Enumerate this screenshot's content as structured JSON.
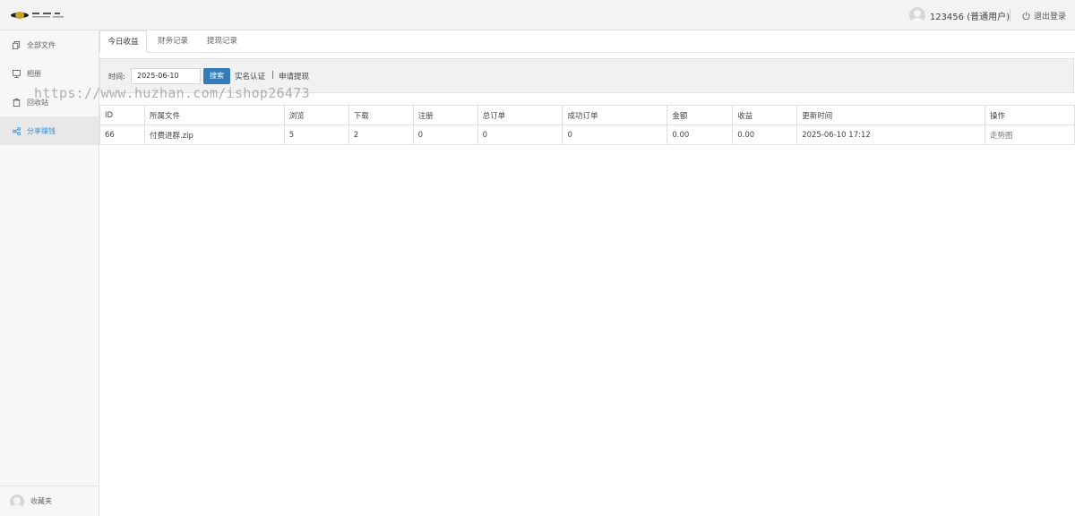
{
  "header": {
    "user_name": "123456 (普通用户)",
    "logout_label": "退出登录"
  },
  "sidebar": {
    "items": [
      {
        "label": "全部文件",
        "icon": "files-icon"
      },
      {
        "label": "相册",
        "icon": "monitor-icon"
      },
      {
        "label": "回收站",
        "icon": "trash-icon"
      },
      {
        "label": "分享赚钱",
        "icon": "share-icon",
        "active": true
      }
    ],
    "favorites_label": "收藏夹"
  },
  "watermark": "https://www.huzhan.com/ishop26473",
  "tabs": [
    {
      "label": "今日收益",
      "active": true
    },
    {
      "label": "财务记录"
    },
    {
      "label": "提现记录"
    }
  ],
  "filter": {
    "time_label": "时间:",
    "date_value": "2025-06-10",
    "search_label": "搜索",
    "verify_label": "实名认证",
    "separator": "|",
    "withdraw_label": "申请提现"
  },
  "table": {
    "headers": [
      "ID",
      "所属文件",
      "浏览",
      "下载",
      "注册",
      "总订单",
      "成功订单",
      "金额",
      "收益",
      "更新时间",
      "操作"
    ],
    "rows": [
      [
        "66",
        "付费进群.zip",
        "5",
        "2",
        "0",
        "0",
        "0",
        "0.00",
        "0.00",
        "2025-06-10 17:12",
        "走势图"
      ]
    ]
  },
  "colors": {
    "accent": "#337ab7",
    "active_nav_text": "#3b8ed8",
    "header_bg": "#f3f3f3",
    "sidebar_bg": "#f7f7f7"
  }
}
